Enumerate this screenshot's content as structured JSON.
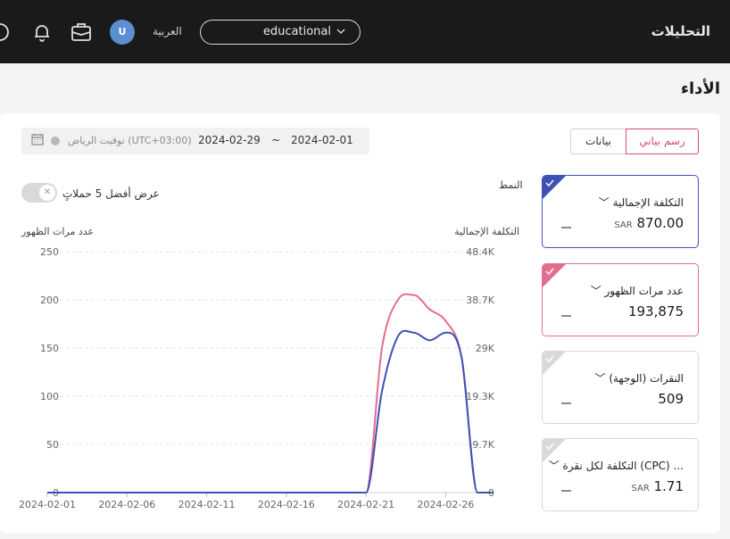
{
  "header": {
    "title": "التحليلات",
    "account": "educational",
    "language": "العربية",
    "avatar_initial": "U"
  },
  "page": {
    "title": "الأداء"
  },
  "date_range": {
    "start": "2024-02-01",
    "separator": "~",
    "end": "2024-02-29",
    "timezone": "توقيت الرياض (UTC+03:00)"
  },
  "view_tabs": {
    "chart": "رسم بياني",
    "data": "بيانات"
  },
  "mode_label": "النمط",
  "toggle": {
    "label": "عرض أفضل 5 حملاتٍ",
    "on": false
  },
  "metrics": [
    {
      "label": "التكلفة الإجمالية",
      "value": "870.00",
      "currency": "SAR",
      "selected": true,
      "color": "#3f51b5"
    },
    {
      "label": "عدد مرات الظهور",
      "value": "193,875",
      "currency": "",
      "selected": true,
      "color": "#e36d8f"
    },
    {
      "label": "النقرات (الوجهة)",
      "value": "509",
      "currency": "",
      "selected": false,
      "color": "#d9d9d9"
    },
    {
      "label": "التكلفة لكل نقرة (CPC) ...",
      "value": "1.71",
      "currency": "SAR",
      "selected": false,
      "color": "#d9d9d9"
    }
  ],
  "chart_data": {
    "type": "line",
    "left_axis": {
      "label": "عدد مرات الظهور",
      "ticks": [
        "250",
        "200",
        "150",
        "100",
        "50",
        "0"
      ],
      "range": [
        0,
        250
      ]
    },
    "right_axis": {
      "label": "التكلفة الإجمالية",
      "ticks": [
        "48.4K",
        "38.7K",
        "29K",
        "19.3K",
        "9.7K",
        "0"
      ],
      "range": [
        0,
        48400
      ]
    },
    "x_ticks": [
      "2024-02-01",
      "2024-02-06",
      "2024-02-11",
      "2024-02-16",
      "2024-02-21",
      "2024-02-26"
    ],
    "x_range": [
      "2024-02-01",
      "2024-02-29"
    ],
    "grid": true,
    "series": [
      {
        "color": "#e36d8f",
        "axis": "left",
        "points": [
          [
            "2024-02-01",
            0
          ],
          [
            "2024-02-21",
            0
          ],
          [
            "2024-02-22",
            150
          ],
          [
            "2024-02-23",
            200
          ],
          [
            "2024-02-24",
            205
          ],
          [
            "2024-02-25",
            190
          ],
          [
            "2024-02-26",
            178
          ],
          [
            "2024-02-27",
            140
          ],
          [
            "2024-02-28",
            0
          ],
          [
            "2024-02-29",
            0
          ]
        ]
      },
      {
        "color": "#3f51b5",
        "axis": "left",
        "points": [
          [
            "2024-02-01",
            0
          ],
          [
            "2024-02-21",
            0
          ],
          [
            "2024-02-22",
            105
          ],
          [
            "2024-02-23",
            162
          ],
          [
            "2024-02-24",
            166
          ],
          [
            "2024-02-25",
            158
          ],
          [
            "2024-02-26",
            166
          ],
          [
            "2024-02-27",
            140
          ],
          [
            "2024-02-28",
            0
          ],
          [
            "2024-02-29",
            0
          ]
        ]
      }
    ]
  }
}
